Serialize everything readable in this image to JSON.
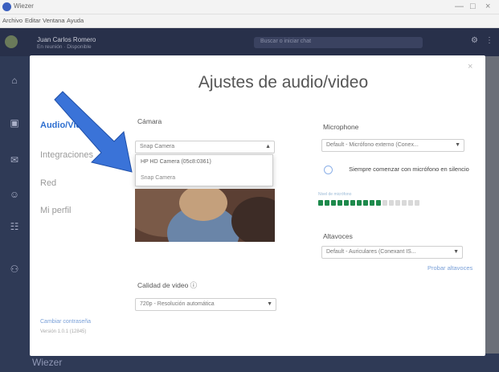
{
  "window": {
    "title": "Wiezer",
    "menu": [
      "Archivo",
      "Editar",
      "Ventana",
      "Ayuda"
    ],
    "controls": {
      "minimize": "—",
      "maximize": "□",
      "close": "×"
    }
  },
  "app": {
    "user_name": "Juan Carlos Romero",
    "user_status": "En reunión · Disponible",
    "search_placeholder": "Buscar o iniciar chat",
    "brand": "Wiezer",
    "rail_icons": [
      "home-icon",
      "calendar-icon",
      "chat-icon",
      "contacts-icon",
      "group-icon",
      "team-icon"
    ]
  },
  "modal": {
    "title": "Ajustes de audio/video",
    "close": "×",
    "nav": [
      {
        "label": "Audio/Video",
        "active": true
      },
      {
        "label": "Integraciones",
        "active": false
      },
      {
        "label": "Red",
        "active": false
      },
      {
        "label": "Mi perfil",
        "active": false
      }
    ],
    "footer_link": "Cambiar contraseña",
    "footer_version": "Versión 1.0.1 (12845)"
  },
  "camera": {
    "label": "Cámara",
    "selected": "Snap Camera",
    "options": [
      "HP HD Camera (05c8:0361)",
      "Snap Camera"
    ]
  },
  "video_quality": {
    "label": "Calidad de video ⓘ",
    "selected": "720p - Resolución automática"
  },
  "microphone": {
    "label": "Microphone",
    "selected": "Default - Micrófono externo (Conex...",
    "toggle_text": "Siempre comenzar con micrófono en silencio",
    "level_label": "Nivel de micrófono",
    "level_segments_on": 10,
    "level_segments_total": 16
  },
  "speakers": {
    "label": "Altavoces",
    "selected": "Default - Auriculares (Conexant IS...",
    "test_link": "Probar altavoces"
  },
  "colors": {
    "accent": "#2e6fd0",
    "meter_on": "#1e8a4c",
    "arrow": "#3a73d8"
  }
}
